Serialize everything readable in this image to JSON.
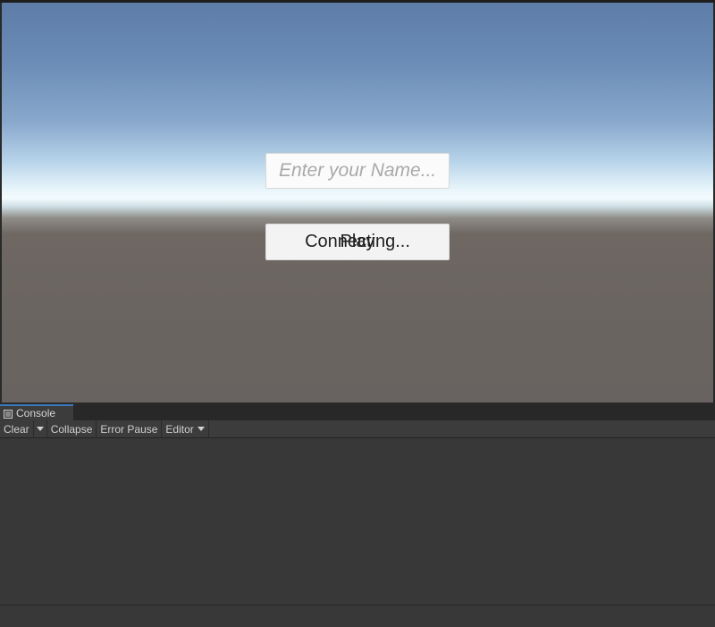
{
  "game": {
    "name_input": {
      "placeholder": "Enter your Name...",
      "value": ""
    },
    "play_button": {
      "label": "Play",
      "overlay_label": "Connecting..."
    }
  },
  "console": {
    "tab_label": "Console",
    "tab_icon": "console-list-icon",
    "toolbar": {
      "clear_label": "Clear",
      "collapse_label": "Collapse",
      "error_pause_label": "Error Pause",
      "editor_label": "Editor"
    }
  },
  "colors": {
    "sky_top": "#5d7da8",
    "horizon": "#f3fbfd",
    "ground": "#6b6561",
    "panel_bg": "#383838",
    "tab_accent": "#3a79bb"
  }
}
